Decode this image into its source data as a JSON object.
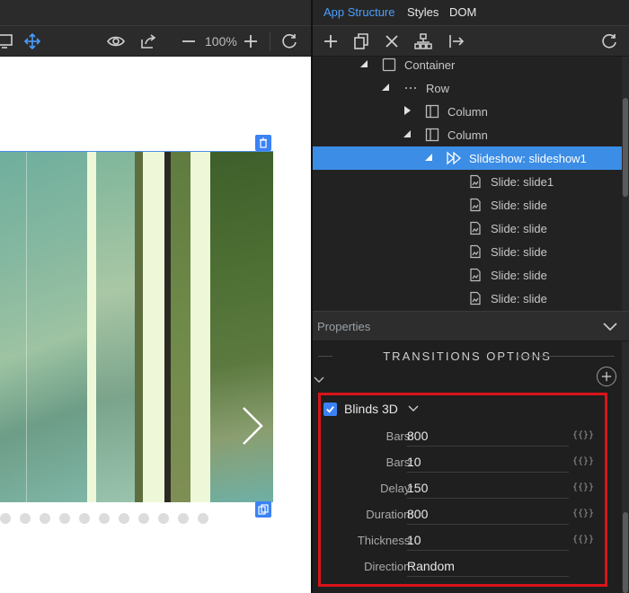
{
  "tabs": [
    {
      "label": "App Structure"
    },
    {
      "label": "Styles"
    },
    {
      "label": "DOM"
    }
  ],
  "left_toolbar": {
    "zoom": "100%"
  },
  "tree": [
    {
      "label": "Container",
      "icon": "container-icon",
      "toggle": "expanded"
    },
    {
      "label": "Row",
      "icon": "row-icon",
      "toggle": "expanded"
    },
    {
      "label": "Column",
      "icon": "column-icon",
      "toggle": "collapsed"
    },
    {
      "label": "Column",
      "icon": "column-icon",
      "toggle": "expanded"
    },
    {
      "label": "Slideshow: slideshow1",
      "icon": "slideshow-icon",
      "toggle": "expanded",
      "selected": true
    },
    {
      "label": "Slide: slide1",
      "icon": "slide-icon"
    },
    {
      "label": "Slide: slide",
      "icon": "slide-icon"
    },
    {
      "label": "Slide: slide",
      "icon": "slide-icon"
    },
    {
      "label": "Slide: slide",
      "icon": "slide-icon"
    },
    {
      "label": "Slide: slide",
      "icon": "slide-icon"
    },
    {
      "label": "Slide: slide",
      "icon": "slide-icon"
    }
  ],
  "properties": {
    "header": "Properties",
    "section_title": "TRANSITIONS OPTIONS",
    "transition": {
      "label": "Blinds 3D",
      "checked": true
    },
    "rows": [
      {
        "label": "Bars:",
        "value": "800",
        "bind": "{{}}"
      },
      {
        "label": "Bars:",
        "value": "10",
        "bind": "{{}}"
      },
      {
        "label": "Delay:",
        "value": "150",
        "bind": "{{}}"
      },
      {
        "label": "Duration:",
        "value": "800",
        "bind": "{{}}"
      },
      {
        "label": "Thickness:",
        "value": "10",
        "bind": "{{}}"
      },
      {
        "label": "Direction:",
        "value": "Random",
        "bind": ""
      }
    ]
  },
  "colors": {
    "accent": "#3b8de6",
    "highlight_border": "#d9141a",
    "tab_active": "#4a9eff",
    "selection_frame": "#4d8fe6"
  },
  "slideshow": {
    "dot_count": 11
  }
}
